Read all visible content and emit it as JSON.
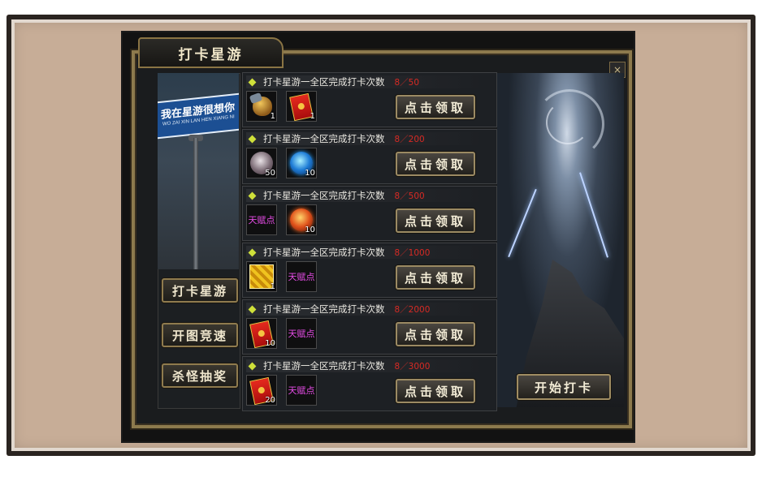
{
  "window": {
    "title": "打卡星游",
    "close_glyph": "×"
  },
  "sign": {
    "text": "我在星游很想你",
    "sub": "WO ZAI XIN LAN HEN XIANG NI"
  },
  "sidebar": {
    "items": [
      {
        "label": "打卡星游"
      },
      {
        "label": "开图竞速"
      },
      {
        "label": "杀怪抽奖"
      }
    ]
  },
  "rows": [
    {
      "task": "打卡星游一全区完成打卡次数",
      "progress": "8／50",
      "rewards": [
        {
          "icon": "pot-icon",
          "qty": "1"
        },
        {
          "icon": "red-envelope-icon",
          "qty": "1"
        }
      ],
      "button": "点击领取"
    },
    {
      "task": "打卡星游一全区完成打卡次数",
      "progress": "8／200",
      "rewards": [
        {
          "icon": "gray-orb-icon",
          "qty": "50"
        },
        {
          "icon": "blue-orb-icon",
          "qty": "10"
        }
      ],
      "button": "点击领取"
    },
    {
      "task": "打卡星游一全区完成打卡次数",
      "progress": "8／500",
      "rewards": [
        {
          "icon": "talent-points",
          "label": "天赋点"
        },
        {
          "icon": "fire-orb-icon",
          "qty": "10"
        }
      ],
      "button": "点击领取"
    },
    {
      "task": "打卡星游一全区完成打卡次数",
      "progress": "8／1000",
      "rewards": [
        {
          "icon": "gold-seal-icon",
          "qty": "1"
        },
        {
          "icon": "talent-points",
          "label": "天赋点"
        }
      ],
      "button": "点击领取"
    },
    {
      "task": "打卡星游一全区完成打卡次数",
      "progress": "8／2000",
      "rewards": [
        {
          "icon": "red-envelope-icon",
          "qty": "10"
        },
        {
          "icon": "talent-points",
          "label": "天赋点"
        }
      ],
      "button": "点击领取"
    },
    {
      "task": "打卡星游一全区完成打卡次数",
      "progress": "8／3000",
      "rewards": [
        {
          "icon": "red-envelope-icon",
          "qty": "20"
        },
        {
          "icon": "talent-points",
          "label": "天赋点"
        }
      ],
      "button": "点击领取"
    }
  ],
  "start_button": "开始打卡",
  "colors": {
    "progress": "#d72a24",
    "talent": "#e64ce6",
    "frame_gold": "#8d7a4d"
  }
}
